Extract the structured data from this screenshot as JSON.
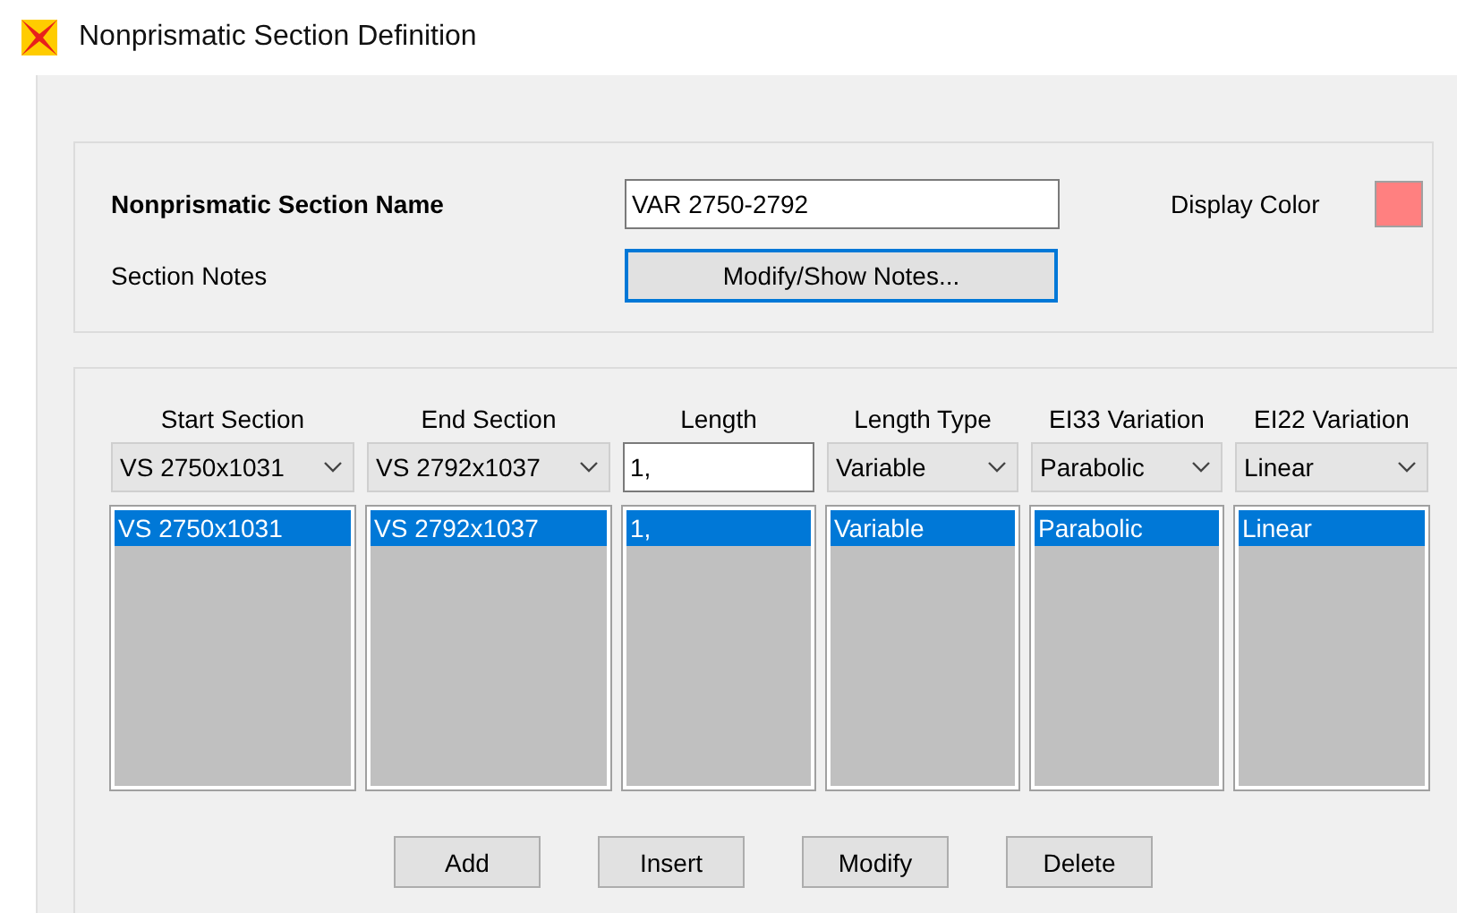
{
  "window": {
    "title": "Nonprismatic Section Definition"
  },
  "name_field": {
    "label": "Nonprismatic Section Name",
    "value": "VAR 2750-2792"
  },
  "display_color": {
    "label": "Display Color",
    "color": "#ff8080"
  },
  "notes": {
    "label": "Section Notes",
    "button": "Modify/Show Notes..."
  },
  "columns": [
    {
      "header": "Start Section",
      "kind": "combo",
      "value": "VS 2750x1031",
      "items": [
        {
          "text": "VS 2750x1031",
          "selected": true
        }
      ]
    },
    {
      "header": "End Section",
      "kind": "combo",
      "value": "VS 2792x1037",
      "items": [
        {
          "text": "VS 2792x1037",
          "selected": true
        }
      ]
    },
    {
      "header": "Length",
      "kind": "input",
      "value": "1,",
      "items": [
        {
          "text": "1,",
          "selected": true
        }
      ]
    },
    {
      "header": "Length Type",
      "kind": "combo",
      "value": "Variable",
      "items": [
        {
          "text": "Variable",
          "selected": true
        }
      ]
    },
    {
      "header": "EI33 Variation",
      "kind": "combo",
      "value": "Parabolic",
      "items": [
        {
          "text": "Parabolic",
          "selected": true
        }
      ]
    },
    {
      "header": "EI22 Variation",
      "kind": "combo",
      "value": "Linear",
      "items": [
        {
          "text": "Linear",
          "selected": true
        }
      ]
    }
  ],
  "buttons": [
    "Add",
    "Insert",
    "Modify",
    "Delete"
  ]
}
